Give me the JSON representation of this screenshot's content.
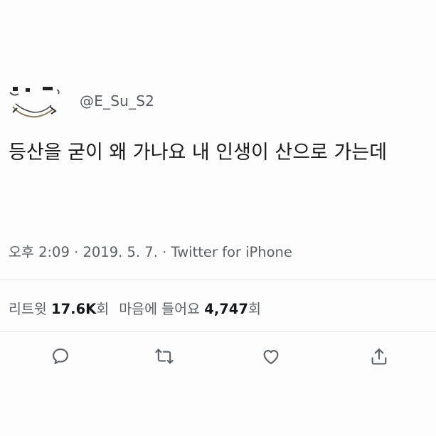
{
  "tweet": {
    "handle": "@E_Su_S2",
    "text": "등산을 굳이 왜 가나요 내 인생이 산으로 가는데",
    "meta": {
      "time": "오후 2:09",
      "separator": " · ",
      "date": "2019. 5. 7.",
      "source": "Twitter for iPhone"
    },
    "stats": {
      "retweets_label": "리트윗",
      "retweets_value": "17.6K",
      "retweets_suffix": "회",
      "likes_label": "마음에 들어요",
      "likes_value": "4,747",
      "likes_suffix": "회"
    }
  },
  "actions": {
    "icons": [
      "reply-icon",
      "retweet-icon",
      "like-icon",
      "share-icon"
    ]
  },
  "colors": {
    "icon": "#5b6166",
    "divider": "#e3e6e8",
    "handle": "#555b61"
  }
}
